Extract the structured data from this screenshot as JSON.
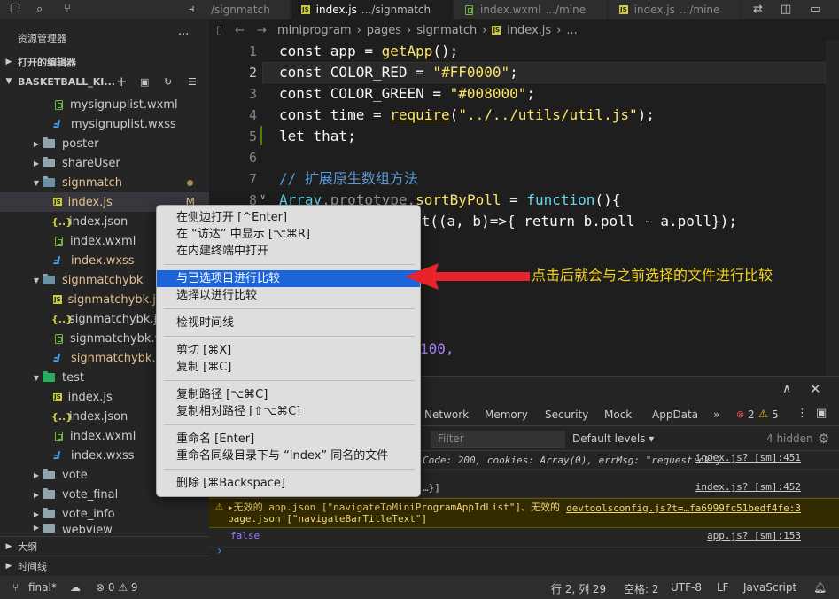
{
  "tabs": [
    {
      "name": "/signmatch",
      "dir": ""
    },
    {
      "name": "index.js",
      "dir": ".../signmatch"
    },
    {
      "name": "index.wxml",
      "dir": ".../mine"
    },
    {
      "name": "index.js",
      "dir": ".../mine"
    }
  ],
  "js_badge": "JS",
  "sidebar": {
    "title": "资源管理器",
    "more": "···",
    "open_editors": "打开的编辑器",
    "project": "BASKETBALL_KI...",
    "outline": "大纲",
    "timeline": "时间线",
    "rows": [
      {
        "label": "mysignuplist.wxml"
      },
      {
        "label": "mysignuplist.wxss"
      },
      {
        "label": "poster"
      },
      {
        "label": "shareUser"
      },
      {
        "label": "signmatch"
      },
      {
        "label": "index.js",
        "status": "M"
      },
      {
        "label": "index.json"
      },
      {
        "label": "index.wxml"
      },
      {
        "label": "index.wxss"
      },
      {
        "label": "signmatchybk"
      },
      {
        "label": "signmatchybk.js"
      },
      {
        "label": "signmatchybk.json"
      },
      {
        "label": "signmatchybk.wxml"
      },
      {
        "label": "signmatchybk.wxss"
      },
      {
        "label": "test"
      },
      {
        "label": "index.js"
      },
      {
        "label": "index.json"
      },
      {
        "label": "index.wxml"
      },
      {
        "label": "index.wxss"
      },
      {
        "label": "vote"
      },
      {
        "label": "vote_final"
      },
      {
        "label": "vote_info"
      },
      {
        "label": "webview"
      }
    ]
  },
  "breadcrumb": [
    "miniprogram",
    "pages",
    "signmatch",
    "index.js",
    "..."
  ],
  "editor": {
    "line_numbers": [
      "1",
      "2",
      "3",
      "4",
      "5",
      "6",
      "7",
      "8"
    ],
    "lines": [
      {
        "a": "const app = ",
        "b": "getApp",
        "c": "();"
      },
      {
        "a": "const COLOR_RED = ",
        "b": "\"#FF0000\"",
        "c": ";"
      },
      {
        "a": "const COLOR_GREEN = ",
        "b": "\"#008000\"",
        "c": ";"
      },
      {
        "a": "const time = ",
        "b": "require",
        "c": "(",
        "d": "\"../../utils/util.js\"",
        "e": ");"
      },
      {
        "a": "let that;"
      },
      {
        "a": ""
      },
      {
        "comment": "// 扩展原生数组方法"
      },
      {
        "a": "Array",
        "b": ".prototype.",
        "c": "sortByPoll",
        "d": " = ",
        "e": "function",
        "f": "(){"
      },
      {
        "a": "rt((a, b)=>{ return b.poll - a.poll});"
      },
      {
        "a": "-,"
      },
      {
        "a": "100,"
      }
    ]
  },
  "context_menu": {
    "items": [
      "在侧边打开 [^Enter]",
      "在 “访达” 中显示 [⌥⌘R]",
      "在内建终端中打开",
      "与已选项目进行比较",
      "选择以进行比较",
      "检视时间线",
      "剪切 [⌘X]",
      "复制 [⌘C]",
      "复制路径 [⌥⌘C]",
      "复制相对路径 [⇧⌥⌘C]",
      "重命名 [Enter]",
      "重命名同级目录下与 “index” 同名的文件",
      "删除 [⌘Backspace]"
    ],
    "highlighted_index": 3
  },
  "annotation": "点击后就会与之前选择的文件进行比较",
  "devtools": {
    "tabs": [
      "Network",
      "Memory",
      "Security",
      "Mock",
      "AppData",
      "»"
    ],
    "errors": "2",
    "warnings": "5",
    "filter_placeholder": "Filter",
    "levels": "Default levels ▾",
    "hidden": "4 hidden",
    "logs": [
      {
        "text": "Code: 200, cookies: Array(0), errMsg: \"request:ok\"}",
        "link": "index.js? [sm]:451"
      },
      {
        "text": "…}]",
        "link": "index.js? [sm]:452"
      },
      {
        "text": "▸无效的 app.json [\"navigateToMiniProgramAppIdList\"]、无效的 page.json [\"navigateBarTitleText\"]",
        "link": "devtoolsconfig.js?t=…fa6999fc51bedf4fe:3"
      },
      {
        "text": "false",
        "link": "app.js? [sm]:153"
      }
    ],
    "prompt": "›"
  },
  "status": {
    "branch": "final*",
    "problems": "⊗ 0 ⚠ 9",
    "position": "行 2, 列 29",
    "spaces": "空格: 2",
    "encoding": "UTF-8",
    "eol": "LF",
    "language": "JavaScript"
  },
  "colors": {
    "highlight": "#1b64d9",
    "annotation": "#f5d21a",
    "arrow": "#e8232a"
  }
}
